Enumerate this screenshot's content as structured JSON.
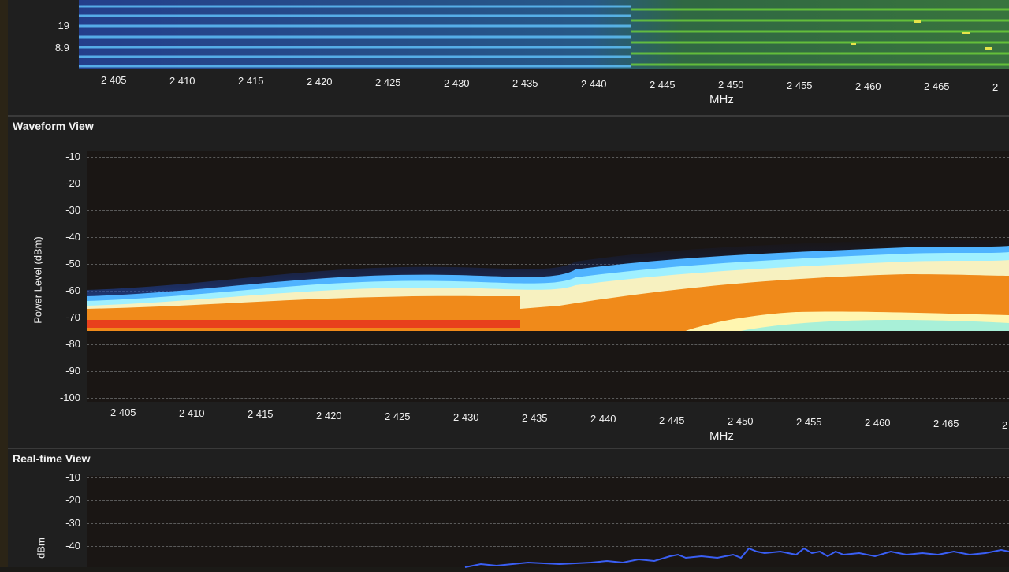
{
  "colors": {
    "background": "#1f1f1f",
    "waterfall_blue": "#2a5cc9",
    "waterfall_green": "#4da82a",
    "waveform_orange": "#f08a1a",
    "waveform_red": "#e8401c",
    "waveform_cyan": "#7fe2ff",
    "realtime_trace": "#3a5ff5"
  },
  "top_panel": {
    "ytick_labels": [
      "19",
      "8.9"
    ],
    "xlabel": "MHz",
    "xtick_labels": [
      "2 405",
      "2 410",
      "2 415",
      "2 420",
      "2 425",
      "2 430",
      "2 435",
      "2 440",
      "2 445",
      "2 450",
      "2 455",
      "2 460",
      "2 465",
      "2"
    ]
  },
  "waveform_view": {
    "title": "Waveform View",
    "ylabel": "Power Level (dBm)",
    "xlabel": "MHz",
    "ytick_labels": [
      "-10",
      "-20",
      "-30",
      "-40",
      "-50",
      "-60",
      "-70",
      "-80",
      "-90",
      "-100"
    ],
    "xtick_labels": [
      "2 405",
      "2 410",
      "2 415",
      "2 420",
      "2 425",
      "2 430",
      "2 435",
      "2 440",
      "2 445",
      "2 450",
      "2 455",
      "2 460",
      "2 465",
      "2"
    ]
  },
  "realtime_view": {
    "title": "Real-time View",
    "ylabel": "dBm",
    "ytick_labels": [
      "-10",
      "-20",
      "-30",
      "-40"
    ]
  }
}
